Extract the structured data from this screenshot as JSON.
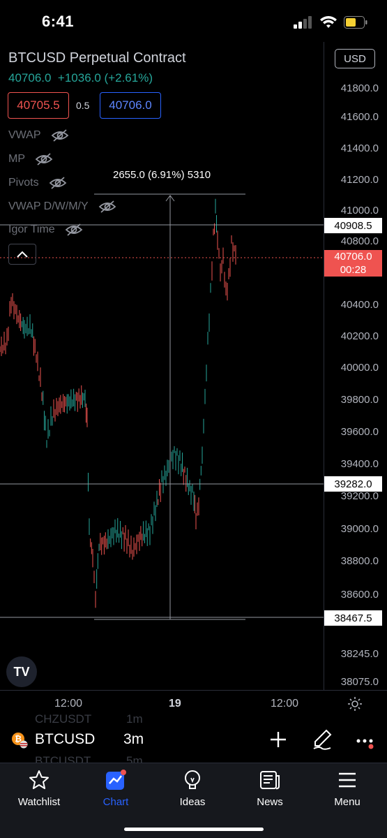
{
  "status": {
    "time": "6:41"
  },
  "header": {
    "title": "BTCUSD Perpetual Contract",
    "quote": "40706.0  +1036.0 (+2.61%)",
    "bid": "40705.5",
    "spread": "0.5",
    "ask": "40706.0"
  },
  "indicators": [
    "VWAP",
    "MP",
    "Pivots",
    "VWAP D/W/M/Y",
    "Igor Time"
  ],
  "axis": {
    "currency": "USD",
    "ticks": [
      "41800.0",
      "41600.0",
      "41400.0",
      "41200.0",
      "41000.0",
      "40800.0",
      "40400.0",
      "40200.0",
      "40000.0",
      "39800.0",
      "39600.0",
      "39400.0",
      "39200.0",
      "39000.0",
      "38800.0",
      "38600.0",
      "38245.0",
      "38075.0"
    ],
    "label_high": "40908.5",
    "label_low": "39282.0",
    "label_bottom": "38467.5",
    "label_current_price": "40706.0",
    "label_current_timer": "00:28"
  },
  "measure": "2655.0 (6.91%) 5310",
  "time_axis": [
    "12:00",
    "19",
    "12:00"
  ],
  "symbol_bar": {
    "ghost_top": "CHZUSDT",
    "ghost_top_tf": "1m",
    "symbol": "BTCUSD",
    "timeframe": "3m",
    "ghost_bottom": "BTCUSDT",
    "ghost_bottom_tf": "5m"
  },
  "nav": {
    "items": [
      {
        "label": "Watchlist",
        "icon": "star-icon"
      },
      {
        "label": "Chart",
        "icon": "chart-icon",
        "active": true
      },
      {
        "label": "Ideas",
        "icon": "lightbulb-icon"
      },
      {
        "label": "News",
        "icon": "newspaper-icon"
      },
      {
        "label": "Menu",
        "icon": "hamburger-icon"
      }
    ]
  },
  "colors": {
    "up": "#26a69a",
    "down": "#ef5350",
    "accent": "#2962ff",
    "tv_logo_label": "TV"
  }
}
